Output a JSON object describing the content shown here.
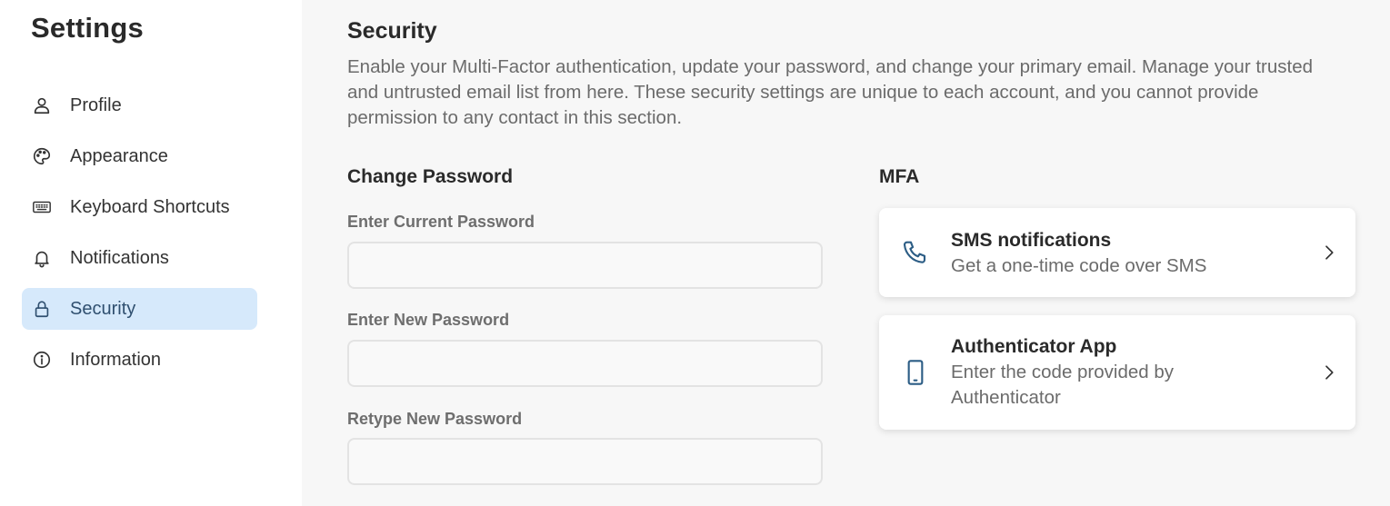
{
  "sidebar": {
    "title": "Settings",
    "items": [
      {
        "label": "Profile",
        "icon": "user-icon"
      },
      {
        "label": "Appearance",
        "icon": "palette-icon"
      },
      {
        "label": "Keyboard Shortcuts",
        "icon": "keyboard-icon"
      },
      {
        "label": "Notifications",
        "icon": "bell-icon"
      },
      {
        "label": "Security",
        "icon": "lock-icon",
        "active": true
      },
      {
        "label": "Information",
        "icon": "info-icon"
      }
    ]
  },
  "main": {
    "title": "Security",
    "description": "Enable your Multi-Factor authentication, update your password, and change your primary email. Manage your trusted and untrusted email list from here. These security settings are unique to each account, and you cannot provide permission to any contact in this section.",
    "change_password": {
      "title": "Change Password",
      "fields": [
        {
          "label": "Enter Current Password",
          "value": ""
        },
        {
          "label": "Enter New Password",
          "value": ""
        },
        {
          "label": "Retype New Password",
          "value": ""
        }
      ]
    },
    "mfa": {
      "title": "MFA",
      "options": [
        {
          "title": "SMS notifications",
          "subtitle": "Get a one-time code over SMS",
          "icon": "phone-icon"
        },
        {
          "title": "Authenticator App",
          "subtitle": "Enter the code provided by Authenticator",
          "icon": "mobile-device-icon"
        }
      ]
    }
  },
  "colors": {
    "sidebar_bg": "#ffffff",
    "main_bg": "#f7f7f7",
    "active_item_bg": "#d6e9fb",
    "accent_icon": "#2c5d85"
  }
}
